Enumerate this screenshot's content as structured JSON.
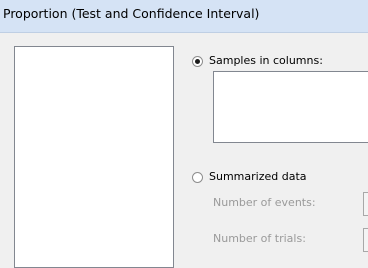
{
  "window": {
    "title": "Proportion (Test and Confidence Interval)"
  },
  "options": {
    "samples_in_columns": {
      "label": "Samples in columns:",
      "selected": true
    },
    "summarized_data": {
      "label": "Summarized data",
      "selected": false
    },
    "number_of_events": {
      "label": "Number of events:",
      "value": ""
    },
    "number_of_trials": {
      "label": "Number of trials:",
      "value": ""
    }
  },
  "colors": {
    "title_bar": "#d5e3f5",
    "dialog_bg": "#f0f0f0",
    "disabled_text": "#9a9a9a"
  }
}
